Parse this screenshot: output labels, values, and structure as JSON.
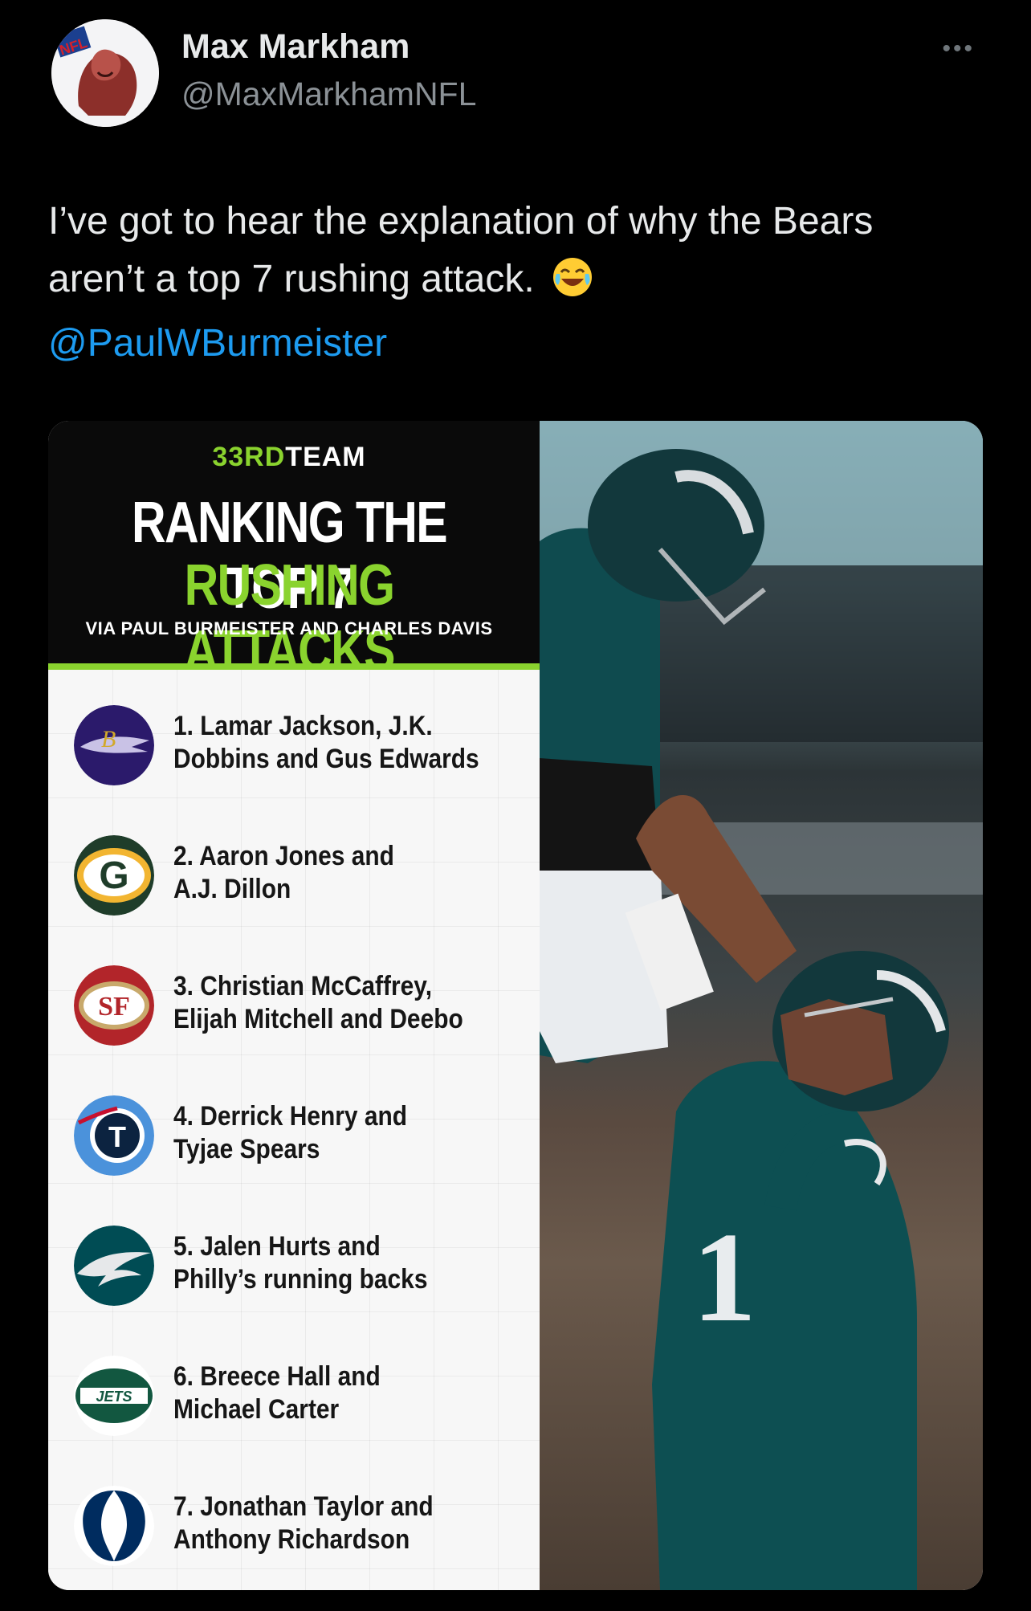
{
  "tweet": {
    "author_name": "Max Markham",
    "author_handle": "@MaxMarkhamNFL",
    "avatar_badge": "NFL",
    "text_line1": "I’ve got to hear the explanation of why the Bears",
    "text_line2": "aren’t a top 7 rushing attack.",
    "emoji_icon": "face-with-tears-of-joy-icon",
    "mention": "@PaulWBurmeister"
  },
  "card": {
    "brand_prefix": "33RD",
    "brand_suffix": "TEAM",
    "headline_line1": "RANKING THE TOP 7",
    "headline_line2": "RUSHING ATTACKS",
    "via": "VIA PAUL BURMEISTER AND CHARLES DAVIS",
    "photo_jersey_number": "1",
    "rankings": [
      {
        "line1": "1. Lamar Jackson, J.K.",
        "line2": "Dobbins and Gus Edwards",
        "team_icon": "ravens-logo-icon"
      },
      {
        "line1": "2. Aaron Jones and",
        "line2": "A.J. Dillon",
        "team_icon": "packers-logo-icon",
        "logo_letter": "G"
      },
      {
        "line1": "3. Christian McCaffrey,",
        "line2": "Elijah Mitchell and Deebo",
        "team_icon": "49ers-logo-icon",
        "logo_letter": "SF"
      },
      {
        "line1": "4. Derrick Henry and",
        "line2": "Tyjae Spears",
        "team_icon": "titans-logo-icon",
        "logo_letter": "T"
      },
      {
        "line1": "5. Jalen Hurts and",
        "line2": "Philly’s running backs",
        "team_icon": "eagles-logo-icon"
      },
      {
        "line1": "6. Breece Hall and",
        "line2": "Michael Carter",
        "team_icon": "jets-logo-icon",
        "logo_letter": "JETS"
      },
      {
        "line1": "7. Jonathan Taylor and",
        "line2": "Anthony Richardson",
        "team_icon": "colts-logo-icon"
      }
    ]
  },
  "colors": {
    "background": "#000000",
    "mention_blue": "#1d9bf0",
    "accent_green": "#8ad32e"
  }
}
